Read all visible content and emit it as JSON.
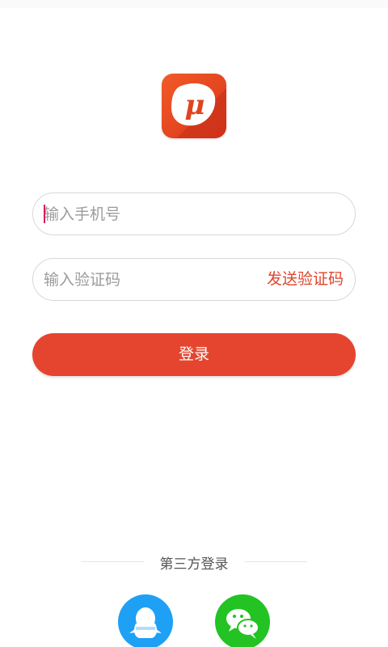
{
  "login": {
    "phone_placeholder": "输入手机号",
    "code_placeholder": "输入验证码",
    "send_code_label": "发送验证码",
    "submit_label": "登录"
  },
  "third_party": {
    "title": "第三方登录",
    "providers": [
      {
        "id": "qq",
        "icon": "qq-icon",
        "color": "#1ea0f5"
      },
      {
        "id": "wechat",
        "icon": "wechat-icon",
        "color": "#22c323"
      }
    ]
  },
  "logo": {
    "icon": "app-logo-mu",
    "glyph": "μ",
    "colors": [
      "#f0562a",
      "#e03c1c",
      "#ffffff"
    ]
  },
  "theme": {
    "accent": "#e5452f",
    "field_border": "#d8d8d8",
    "placeholder": "#9b9b9b"
  }
}
